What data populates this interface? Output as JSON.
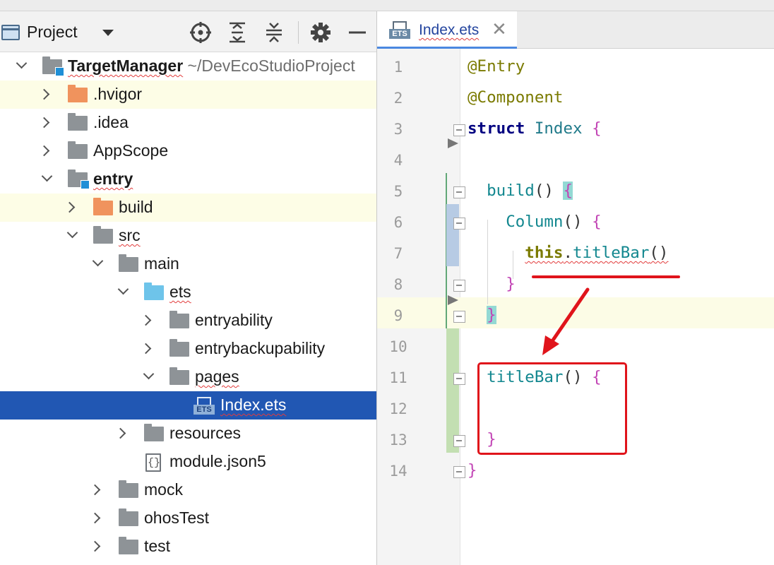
{
  "project_panel": {
    "title": "Project",
    "tools": [
      "crosshair-icon",
      "expand-all-icon",
      "collapse-all-icon",
      "gear-icon",
      "minimize-icon"
    ]
  },
  "tree": [
    {
      "label": "TargetManager",
      "suffix": " ~/DevEcoStudioProject",
      "bold": true,
      "icon": "module-folder-icon",
      "expanded": true
    },
    {
      "label": ".hvigor",
      "icon": "orange-folder-icon",
      "expanded": false,
      "highlight": true
    },
    {
      "label": ".idea",
      "icon": "folder-icon",
      "expanded": false
    },
    {
      "label": "AppScope",
      "icon": "folder-icon",
      "expanded": false
    },
    {
      "label": "entry",
      "bold": true,
      "icon": "module-folder-icon",
      "expanded": true
    },
    {
      "label": "build",
      "icon": "orange-folder-icon",
      "expanded": false,
      "highlight": true
    },
    {
      "label": "src",
      "icon": "folder-icon",
      "expanded": true
    },
    {
      "label": "main",
      "icon": "folder-icon",
      "expanded": true
    },
    {
      "label": "ets",
      "icon": "blue-folder-icon",
      "expanded": true
    },
    {
      "label": "entryability",
      "icon": "folder-icon",
      "expanded": false
    },
    {
      "label": "entrybackupability",
      "icon": "folder-icon",
      "expanded": false
    },
    {
      "label": "pages",
      "icon": "folder-icon",
      "expanded": true
    },
    {
      "label": "Index.ets",
      "icon": "ets-file-icon",
      "selected": true
    },
    {
      "label": "resources",
      "icon": "folder-icon",
      "expanded": false
    },
    {
      "label": "module.json5",
      "icon": "json-file-icon"
    },
    {
      "label": "mock",
      "icon": "folder-icon",
      "expanded": false
    },
    {
      "label": "ohosTest",
      "icon": "folder-icon",
      "expanded": false
    },
    {
      "label": "test",
      "icon": "folder-icon",
      "expanded": false
    }
  ],
  "editor": {
    "tab_label": "Index.ets",
    "tab_icon_label": "ETS",
    "line_numbers": [
      "1",
      "2",
      "3",
      "4",
      "5",
      "6",
      "7",
      "8",
      "9",
      "10",
      "11",
      "12",
      "13",
      "14"
    ],
    "code": {
      "l1": "@Entry",
      "l2": "@Component",
      "l3_kw": "struct",
      "l3_name": "Index",
      "l5_fn": "build",
      "l6_fn": "Column",
      "l7_this": "this",
      "l7_fn": "titleBar",
      "l11_fn": "titleBar"
    },
    "close_glyph": "✕"
  },
  "colors": {
    "selection": "#2157b3",
    "annotation": "#e0141b",
    "bracket": "#c245b5",
    "function": "#12878f"
  }
}
